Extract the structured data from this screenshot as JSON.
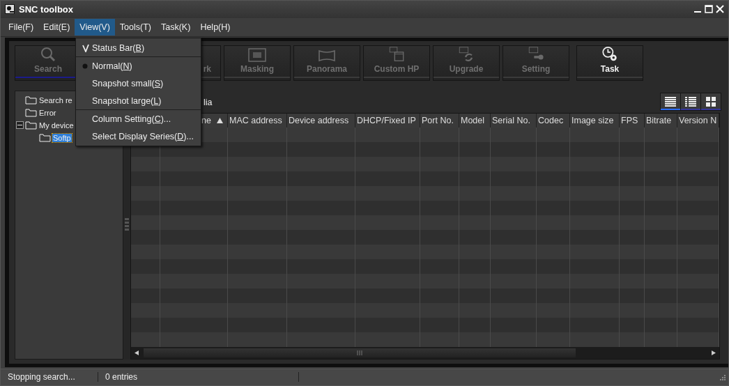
{
  "window": {
    "title": "SNC toolbox"
  },
  "menu_bar": [
    {
      "label": "File(F)",
      "selected": false
    },
    {
      "label": "Edit(E)",
      "selected": false
    },
    {
      "label": "View(V)",
      "selected": true
    },
    {
      "label": "Tools(T)",
      "selected": false
    },
    {
      "label": "Task(K)",
      "selected": false
    },
    {
      "label": "Help(H)",
      "selected": false
    }
  ],
  "view_menu": [
    {
      "kind": "check",
      "text": "Status Bar(",
      "key": "B",
      "tail": ")",
      "checked": true
    },
    {
      "kind": "separator"
    },
    {
      "kind": "radio",
      "text": "Normal(",
      "key": "N",
      "tail": ")",
      "selected": true
    },
    {
      "kind": "radio",
      "text": "Snapshot small(",
      "key": "S",
      "tail": ")",
      "selected": false
    },
    {
      "kind": "radio",
      "text": "Snapshot large(",
      "key": "L",
      "tail": ")",
      "selected": false
    },
    {
      "kind": "separator"
    },
    {
      "kind": "item",
      "text": "Column Setting(",
      "key": "C",
      "tail": ")..."
    },
    {
      "kind": "item",
      "text": "Select Display Series(",
      "key": "D",
      "tail": ")..."
    }
  ],
  "toolbar": [
    {
      "kind": "search",
      "label": "Search",
      "disabled": true,
      "selected": true
    },
    {
      "kind": "hidden"
    },
    {
      "kind": "network",
      "label": "rk",
      "disabled": true,
      "selected": false
    },
    {
      "kind": "masking",
      "label": "Masking",
      "disabled": true,
      "selected": false
    },
    {
      "kind": "panorama",
      "label": "Panorama",
      "disabled": true,
      "selected": false
    },
    {
      "kind": "custom",
      "label": "Custom HP",
      "disabled": true,
      "selected": false
    },
    {
      "kind": "upgrade",
      "label": "Upgrade",
      "disabled": true,
      "selected": false
    },
    {
      "kind": "setting",
      "label": "Setting",
      "disabled": true,
      "selected": false
    },
    {
      "kind": "task",
      "label": "Task",
      "disabled": false,
      "selected": false
    }
  ],
  "tree": [
    {
      "label": "Search re",
      "selected": false
    },
    {
      "label": "Error",
      "selected": false
    },
    {
      "label": "My device",
      "selected": false,
      "expanded": true,
      "children": [
        {
          "label": "Softp",
          "selected": true
        }
      ]
    }
  ],
  "list_title": "lia",
  "view_modes": [
    {
      "kind": "list",
      "selected": true
    },
    {
      "kind": "details",
      "selected": false
    },
    {
      "kind": "grid",
      "selected": false
    }
  ],
  "table": {
    "columns": [
      {},
      {
        "label": "ne",
        "sorted": true
      },
      {
        "label": "MAC address"
      },
      {
        "label": "Device address"
      },
      {
        "label": "DHCP/Fixed IP"
      },
      {
        "label": "Port No."
      },
      {
        "label": "Model"
      },
      {
        "label": "Serial No."
      },
      {
        "label": "Codec"
      },
      {
        "label": "Image size"
      },
      {
        "label": "FPS"
      },
      {
        "label": "Bitrate"
      },
      {
        "label": "Version N"
      }
    ]
  },
  "status_bar": [
    "Stopping search...",
    "0 entries"
  ]
}
